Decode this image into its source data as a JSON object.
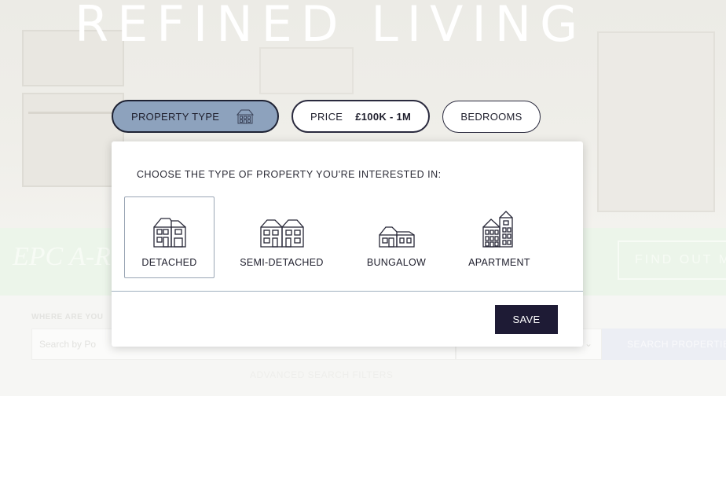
{
  "hero": {
    "title": "REFINED LIVING",
    "banner_text": "EPC A-Ra",
    "banner_button": "FIND OUT M"
  },
  "search": {
    "where_label": "WHERE ARE YOU",
    "placeholder": "Search by Po",
    "button": "SEARCH PROPERTIE",
    "advanced": "ADVANCED SEARCH FILTERS"
  },
  "filters": {
    "property_type_label": "PROPERTY TYPE",
    "price_label": "PRICE",
    "price_value": "£100K - 1M",
    "bedrooms_label": "BEDROOMS"
  },
  "panel": {
    "heading": "CHOOSE THE TYPE OF PROPERTY YOU'RE INTERESTED IN:",
    "options": [
      {
        "label": "DETACHED",
        "icon": "detached-house-icon",
        "selected": true
      },
      {
        "label": "SEMI-DETACHED",
        "icon": "semi-detached-house-icon",
        "selected": false
      },
      {
        "label": "BUNGALOW",
        "icon": "bungalow-icon",
        "selected": false
      },
      {
        "label": "APARTMENT",
        "icon": "apartment-building-icon",
        "selected": false
      }
    ],
    "save_label": "SAVE"
  },
  "colors": {
    "active_pill": "#8da2bd",
    "dark_navy": "#1e1b35",
    "selected_border": "#9aa6b5"
  }
}
